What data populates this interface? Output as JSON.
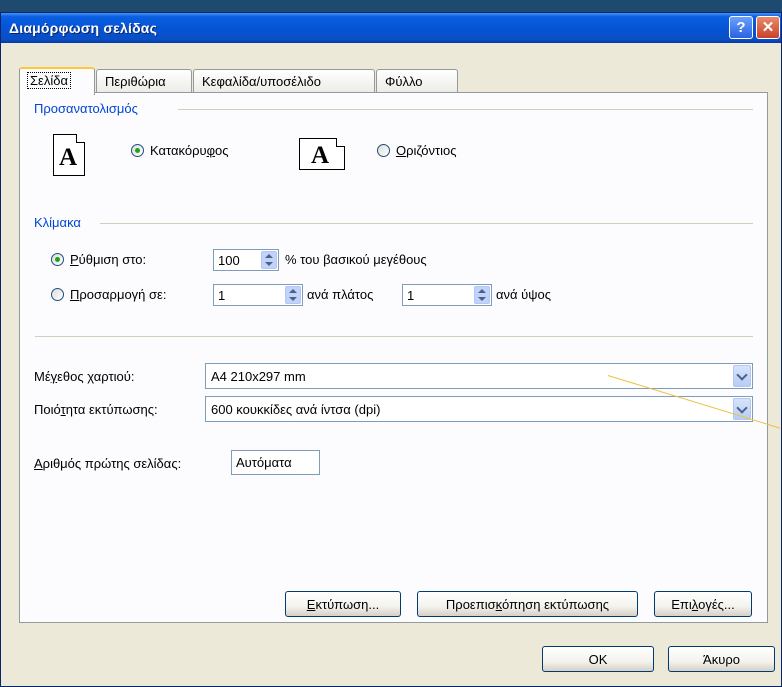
{
  "window": {
    "title": "Διαμόρφωση σελίδας",
    "help_glyph": "?",
    "close_glyph": "✕"
  },
  "tabs": [
    {
      "label": "Σελίδα"
    },
    {
      "label": "Περιθώρια"
    },
    {
      "label": "Κεφαλίδα/υποσέλιδο"
    },
    {
      "label": "Φύλλο"
    }
  ],
  "orientation": {
    "title": "Προσανατολισμός",
    "portrait": {
      "label_pre": "Κατακόρυ",
      "label_key": "φ",
      "label_post": "ος",
      "selected": true
    },
    "landscape": {
      "label_key": "Ο",
      "label_post": "ριζόντιος",
      "selected": false
    },
    "icon_letter": "A"
  },
  "scaling": {
    "title": "Κλίμακα",
    "adjust": {
      "label_key": "Ρ",
      "label_post": "ύθμιση στο:",
      "value": "100",
      "suffix": "% του βασικού μεγέθους",
      "selected": true
    },
    "fit": {
      "label_key": "Π",
      "label_post": "ροσαρμογή σε:",
      "wide": "1",
      "wide_suffix": "ανά πλάτος",
      "tall": "1",
      "tall_suffix": "ανά ύψος",
      "selected": false
    }
  },
  "paper_size": {
    "label_pre": "Μέ",
    "label_key": "γ",
    "label_post": "εθος χαρτιού:",
    "value": "A4 210x297 mm"
  },
  "print_quality": {
    "label_pre": "Ποιό",
    "label_key": "τ",
    "label_post": "ητα εκτύπωσης:",
    "value": "600 κουκκίδες ανά ίντσα (dpi)"
  },
  "first_page": {
    "label_key": "Α",
    "label_post": "ριθμός πρώτης σελίδας:",
    "value": "Αυτόματα"
  },
  "buttons": {
    "print": {
      "label_key": "Ε",
      "label_post": "κτύπωση..."
    },
    "preview": {
      "label_pre": "Προεπισ",
      "label_key": "κ",
      "label_post": "όπηση εκτύπωσης"
    },
    "options": {
      "label_pre": "Επι",
      "label_key": "λ",
      "label_post": "ογές..."
    },
    "ok": "OK",
    "cancel": "Άκυρο"
  },
  "colors": {
    "titlebar": "#0554d6",
    "group_label": "#0046d5",
    "dialog_bg": "#ece9d8"
  }
}
